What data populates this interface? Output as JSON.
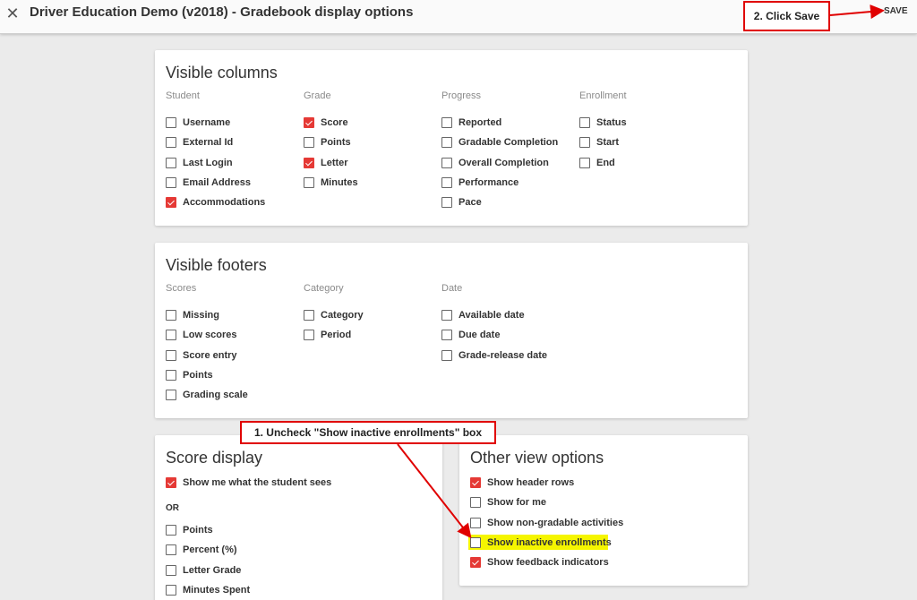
{
  "header": {
    "close_icon": "close-icon",
    "title": "Driver Education Demo (v2018) - Gradebook display options",
    "save_label": "SAVE"
  },
  "callouts": {
    "click_save": "2. Click Save",
    "uncheck": "1. Uncheck \"Show inactive enrollments\" box",
    "color": "#e00000"
  },
  "accent_color": "#e53935",
  "highlight_color": "#f5f500",
  "visible_columns": {
    "title": "Visible columns",
    "groups": [
      {
        "header": "Student",
        "items": [
          {
            "label": "Username",
            "checked": false
          },
          {
            "label": "External Id",
            "checked": false
          },
          {
            "label": "Last Login",
            "checked": false
          },
          {
            "label": "Email Address",
            "checked": false
          },
          {
            "label": "Accommodations",
            "checked": true
          }
        ]
      },
      {
        "header": "Grade",
        "items": [
          {
            "label": "Score",
            "checked": true
          },
          {
            "label": "Points",
            "checked": false
          },
          {
            "label": "Letter",
            "checked": true
          },
          {
            "label": "Minutes",
            "checked": false
          }
        ]
      },
      {
        "header": "Progress",
        "items": [
          {
            "label": "Reported",
            "checked": false
          },
          {
            "label": "Gradable Completion",
            "checked": false
          },
          {
            "label": "Overall Completion",
            "checked": false
          },
          {
            "label": "Performance",
            "checked": false
          },
          {
            "label": "Pace",
            "checked": false
          }
        ]
      },
      {
        "header": "Enrollment",
        "items": [
          {
            "label": "Status",
            "checked": false
          },
          {
            "label": "Start",
            "checked": false
          },
          {
            "label": "End",
            "checked": false
          }
        ]
      }
    ]
  },
  "visible_footers": {
    "title": "Visible footers",
    "groups": [
      {
        "header": "Scores",
        "items": [
          {
            "label": "Missing",
            "checked": false
          },
          {
            "label": "Low scores",
            "checked": false
          },
          {
            "label": "Score entry",
            "checked": false
          },
          {
            "label": "Points",
            "checked": false
          },
          {
            "label": "Grading scale",
            "checked": false
          }
        ]
      },
      {
        "header": "Category",
        "items": [
          {
            "label": "Category",
            "checked": false
          },
          {
            "label": "Period",
            "checked": false
          }
        ]
      },
      {
        "header": "Date",
        "items": [
          {
            "label": "Available date",
            "checked": false
          },
          {
            "label": "Due date",
            "checked": false
          },
          {
            "label": "Grade-release date",
            "checked": false
          }
        ]
      }
    ]
  },
  "score_display": {
    "title": "Score display",
    "show_student": {
      "label": "Show me what the student sees",
      "checked": true
    },
    "or_text": "OR",
    "items": [
      {
        "label": "Points",
        "checked": false
      },
      {
        "label": "Percent (%)",
        "checked": false
      },
      {
        "label": "Letter Grade",
        "checked": false
      },
      {
        "label": "Minutes Spent",
        "checked": false
      }
    ]
  },
  "other_view": {
    "title": "Other view options",
    "items": [
      {
        "label": "Show header rows",
        "checked": true
      },
      {
        "label": "Show for me",
        "checked": false
      },
      {
        "label": "Show non-gradable activities",
        "checked": false
      },
      {
        "label": "Show inactive enrollments",
        "checked": false
      },
      {
        "label": "Show feedback indicators",
        "checked": true
      }
    ]
  }
}
